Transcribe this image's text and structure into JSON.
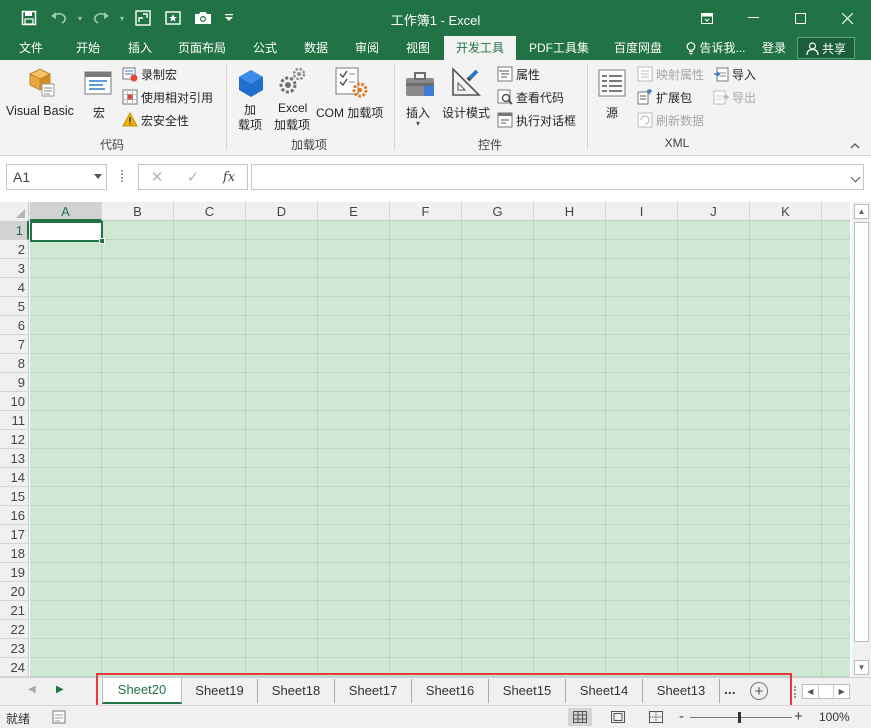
{
  "window": {
    "title": "工作簿1 - Excel"
  },
  "qat": {
    "icons": [
      "save-icon",
      "undo-icon",
      "redo-icon",
      "touch-mode-icon",
      "favorites-icon",
      "camera-icon",
      "customize-qat-icon"
    ]
  },
  "tabs": [
    {
      "label": "文件",
      "active": false
    },
    {
      "label": "开始",
      "active": false
    },
    {
      "label": "插入",
      "active": false
    },
    {
      "label": "页面布局",
      "active": false
    },
    {
      "label": "公式",
      "active": false
    },
    {
      "label": "数据",
      "active": false
    },
    {
      "label": "审阅",
      "active": false
    },
    {
      "label": "视图",
      "active": false
    },
    {
      "label": "开发工具",
      "active": true
    },
    {
      "label": "PDF工具集",
      "active": false
    },
    {
      "label": "百度网盘",
      "active": false
    }
  ],
  "tellme": "告诉我...",
  "login": "登录",
  "share": "共享",
  "ribbon": {
    "code": {
      "label": "代码",
      "visual_basic": "Visual Basic",
      "macros": "宏",
      "record_macro": "录制宏",
      "relative_refs": "使用相对引用",
      "macro_security": "宏安全性"
    },
    "addins": {
      "label": "加载项",
      "addins_line1": "加",
      "addins_line2": "载项",
      "excel_addins_line1": "Excel",
      "excel_addins_line2": "加载项",
      "com_addins": "COM 加载项"
    },
    "controls": {
      "label": "控件",
      "insert": "插入",
      "design_mode": "设计模式",
      "properties": "属性",
      "view_code": "查看代码",
      "run_dialog": "执行对话框"
    },
    "xml": {
      "label": "XML",
      "source": "源",
      "map_properties": "映射属性",
      "expansion_packs": "扩展包",
      "refresh_data": "刷新数据",
      "import": "导入",
      "export": "导出"
    }
  },
  "formula_bar": {
    "name_box": "A1",
    "fx": "fx",
    "cancel": "✕",
    "enter": "✓",
    "value": ""
  },
  "grid": {
    "columns": [
      "A",
      "B",
      "C",
      "D",
      "E",
      "F",
      "G",
      "H",
      "I",
      "J",
      "K"
    ],
    "rows": [
      "1",
      "2",
      "3",
      "4",
      "5",
      "6",
      "7",
      "8",
      "9",
      "10",
      "11",
      "12",
      "13",
      "14",
      "15",
      "16",
      "17",
      "18",
      "19",
      "20",
      "21",
      "22",
      "23",
      "24"
    ],
    "active_cell": "A1",
    "fill_color": "#cfe8d3"
  },
  "sheets": {
    "tabs": [
      "Sheet20",
      "Sheet19",
      "Sheet18",
      "Sheet17",
      "Sheet16",
      "Sheet15",
      "Sheet14",
      "Sheet13"
    ],
    "active": "Sheet20",
    "more": "...",
    "add": "+"
  },
  "status": {
    "ready": "就绪",
    "zoom": "100%",
    "zoom_out": "-",
    "zoom_in": "+"
  },
  "colors": {
    "brand": "#217346",
    "highlight_box": "#e5393f"
  }
}
